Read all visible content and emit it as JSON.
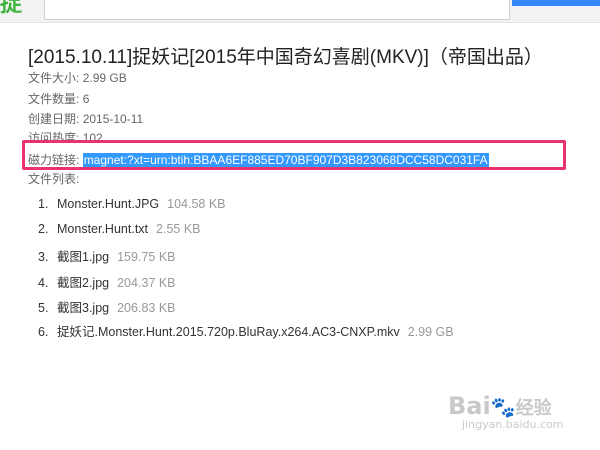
{
  "header": {
    "logo_text": "捉"
  },
  "torrent": {
    "title": "[2015.10.11]捉妖记[2015年中国奇幻喜剧(MKV)]（帝国出品）",
    "meta": [
      {
        "label": "文件大小:",
        "value": "2.99 GB"
      },
      {
        "label": "文件数量:",
        "value": "6"
      },
      {
        "label": "创建日期:",
        "value": "2015-10-11"
      },
      {
        "label": "访问热度:",
        "value": "102"
      }
    ],
    "magnet_label": "磁力链接:",
    "magnet_value": "magnet:?xt=urn:btih:BBAA6EF885ED70BF907D3B823068DCC58DC031FA",
    "files_label": "文件列表:",
    "files": [
      {
        "num": "1.",
        "name": "Monster.Hunt.JPG",
        "size": "104.58 KB"
      },
      {
        "num": "2.",
        "name": "Monster.Hunt.txt",
        "size": "2.55 KB"
      },
      {
        "num": "3.",
        "name": "截图1.jpg",
        "size": "159.75 KB"
      },
      {
        "num": "4.",
        "name": "截图2.jpg",
        "size": "204.37 KB"
      },
      {
        "num": "5.",
        "name": "截图3.jpg",
        "size": "206.83 KB"
      },
      {
        "num": "6.",
        "name": "捉妖记.Monster.Hunt.2015.720p.BluRay.x264.AC3-CNXP.mkv",
        "size": "2.99 GB"
      }
    ]
  },
  "watermark": {
    "brand_left": "Bai",
    "brand_right": "经验",
    "domain": "jingyan.baidu.com"
  },
  "colors": {
    "highlight_border": "#e8336d",
    "selection": "#3399ff",
    "accent_blue": "#3388ff",
    "logo_green": "#3bb33b"
  }
}
